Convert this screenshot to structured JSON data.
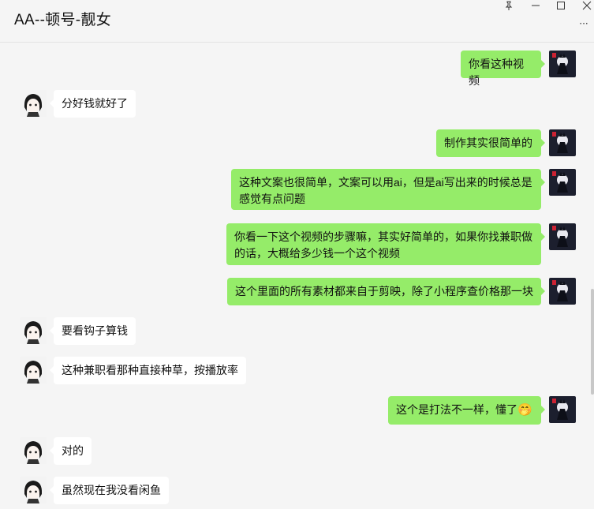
{
  "window": {
    "title": "AA--顿号-靓女",
    "controls": [
      "pin-icon",
      "minimize-icon",
      "maximize-icon",
      "close-icon"
    ],
    "more_label": "···"
  },
  "colors": {
    "outgoing_bubble": "#95ec69",
    "incoming_bubble": "#ffffff",
    "background": "#f5f5f5"
  },
  "messages": [
    {
      "side": "out",
      "text": "你看这种视频"
    },
    {
      "side": "in",
      "text": "分好钱就好了"
    },
    {
      "side": "out",
      "text": "制作其实很简单的"
    },
    {
      "side": "out",
      "text": "这种文案也很简单，文案可以用ai，但是ai写出来的时候总是感觉有点问题"
    },
    {
      "side": "out",
      "text": "你看一下这个视频的步骤嘛，其实好简单的，如果你找兼职做的话，大概给多少钱一个这个视频"
    },
    {
      "side": "out",
      "text": "这个里面的所有素材都来自于剪映，除了小程序查价格那一块"
    },
    {
      "side": "in",
      "text": "要看钩子算钱"
    },
    {
      "side": "in",
      "text": "这种兼职看那种直接种草，按播放率"
    },
    {
      "side": "out",
      "text": "这个是打法不一样，懂了",
      "emoji": "🤭"
    },
    {
      "side": "in",
      "text": "对的"
    },
    {
      "side": "in",
      "text": "虽然现在我没看闲鱼"
    }
  ]
}
